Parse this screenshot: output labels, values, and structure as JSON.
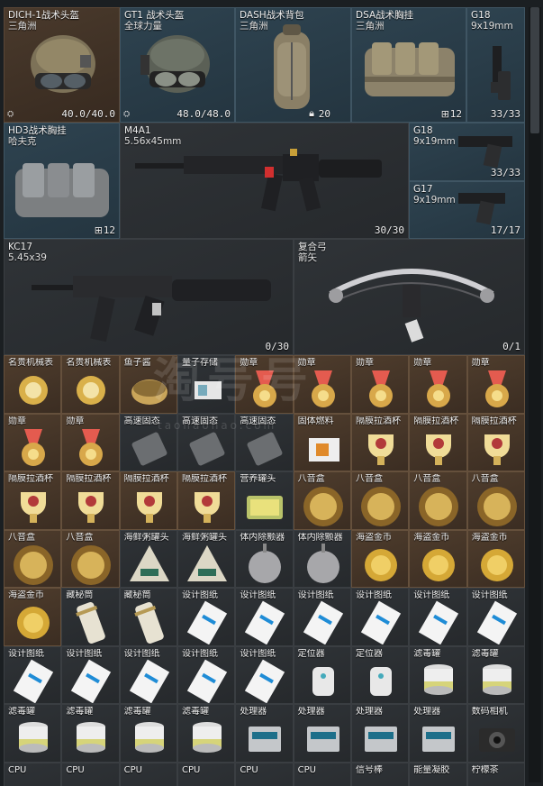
{
  "large_items": [
    {
      "id": "dich1",
      "name": "DICH-1战术头盔",
      "sub": "三角洲",
      "count": "40.0/40.0",
      "badge": "⛭",
      "icon": "helmet-icon"
    },
    {
      "id": "gt1",
      "name": "GT1 战术头盔",
      "sub": "全球力量",
      "count": "48.0/48.0",
      "badge": "⛭",
      "icon": "helmet-icon"
    },
    {
      "id": "dash",
      "name": "DASH战术背包",
      "sub": "三角洲",
      "count": "20",
      "badge": "🔒",
      "icon": "backpack-icon"
    },
    {
      "id": "dsa",
      "name": "DSA战术胸挂",
      "sub": "三角洲",
      "count": "12",
      "badge": "⊞",
      "icon": "chest-rig-icon"
    },
    {
      "id": "g18a",
      "name": "G18",
      "sub": "9x19mm",
      "count": "33/33",
      "icon": "pistol-icon"
    },
    {
      "id": "hd3",
      "name": "HD3战术胸挂",
      "sub": "哈夫克",
      "count": "12",
      "badge": "⊞",
      "icon": "chest-rig-icon"
    },
    {
      "id": "m4a1",
      "name": "M4A1",
      "sub": "5.56x45mm",
      "count": "30/30",
      "icon": "rifle-icon"
    },
    {
      "id": "g18b",
      "name": "G18",
      "sub": "9x19mm",
      "count": "33/33",
      "icon": "pistol-icon"
    },
    {
      "id": "g17",
      "name": "G17",
      "sub": "9x19mm",
      "count": "17/17",
      "icon": "pistol-icon"
    },
    {
      "id": "kc17",
      "name": "KC17",
      "sub": "5.45x39",
      "count": "0/30",
      "icon": "rifle-icon"
    },
    {
      "id": "bow",
      "name": "复合弓",
      "sub": "箭矢",
      "count": "0/1",
      "icon": "bow-icon"
    }
  ],
  "small_rows": [
    [
      "名贵机械表",
      "名贵机械表",
      "鱼子酱",
      "量子存储",
      "勋章",
      "勋章",
      "勋章",
      "勋章",
      "勋章"
    ],
    [
      "勋章",
      "勋章",
      "高速固态",
      "高速固态",
      "高速固态",
      "固体燃料",
      "隔膜拉酒杯",
      "隔膜拉酒杯",
      "隔膜拉酒杯"
    ],
    [
      "隔膜拉酒杯",
      "隔膜拉酒杯",
      "隔膜拉酒杯",
      "隔膜拉酒杯",
      "营养罐头",
      "八音盒",
      "八音盒",
      "八音盒",
      "八音盒"
    ],
    [
      "八音盒",
      "八音盒",
      "海鲜粥罐头",
      "海鲜粥罐头",
      "体内除颤器",
      "体内除颤器",
      "海盗金币",
      "海盗金币",
      "海盗金币"
    ],
    [
      "海盗金币",
      "藏秘筒",
      "藏秘筒",
      "设计图纸",
      "设计图纸",
      "设计图纸",
      "设计图纸",
      "设计图纸",
      "设计图纸"
    ],
    [
      "设计图纸",
      "设计图纸",
      "设计图纸",
      "设计图纸",
      "设计图纸",
      "定位器",
      "定位器",
      "滤毒罐",
      "滤毒罐"
    ],
    [
      "滤毒罐",
      "滤毒罐",
      "滤毒罐",
      "滤毒罐",
      "处理器",
      "处理器",
      "处理器",
      "处理器",
      "数码相机"
    ],
    [
      "CPU",
      "CPU",
      "CPU",
      "CPU",
      "CPU",
      "CPU",
      "信号棒",
      "能量凝胶",
      "柠檬茶"
    ]
  ],
  "watermark": "淘号号",
  "watermark_sub": "taohaohao.com"
}
